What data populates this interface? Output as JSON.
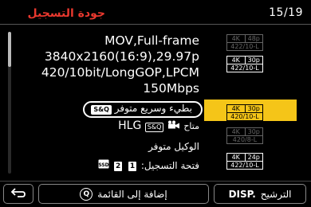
{
  "header": {
    "title": "جودة التسجيل",
    "counter": "15/19"
  },
  "details": {
    "line1": "MOV,Full-frame",
    "line2": "3840x2160(16:9),29.97p",
    "line3": "420/10bit/LongGOP,LPCM",
    "line4": "150Mbps",
    "slow_quick": "بطيء وسريع متوفر",
    "sq_badge": "S&Q",
    "hlg_prefix": "متاح",
    "hlg": "HLG",
    "proxy": "الوكيل متوفر",
    "slot_label": "فتحة التسجيل:",
    "slot_1": "1",
    "slot_2": "2"
  },
  "list": [
    {
      "res": "4K",
      "fps": "48p",
      "codec": "422/10-L"
    },
    {
      "res": "4K",
      "fps": "30p",
      "codec": "422/10-L"
    },
    {
      "res": "4K",
      "fps": "30p",
      "codec": "420/10-L"
    },
    {
      "res": "4K",
      "fps": "30p",
      "codec": "420/8-L"
    },
    {
      "res": "4K",
      "fps": "24p",
      "codec": "422/10-L"
    }
  ],
  "footer": {
    "add_label": "إضافة إلى القائمة",
    "q_icon": "Q",
    "filter_label": "الترشيح",
    "disp": "DISP."
  },
  "colors": {
    "title": "#e8382e",
    "selection": "#f5c518"
  }
}
